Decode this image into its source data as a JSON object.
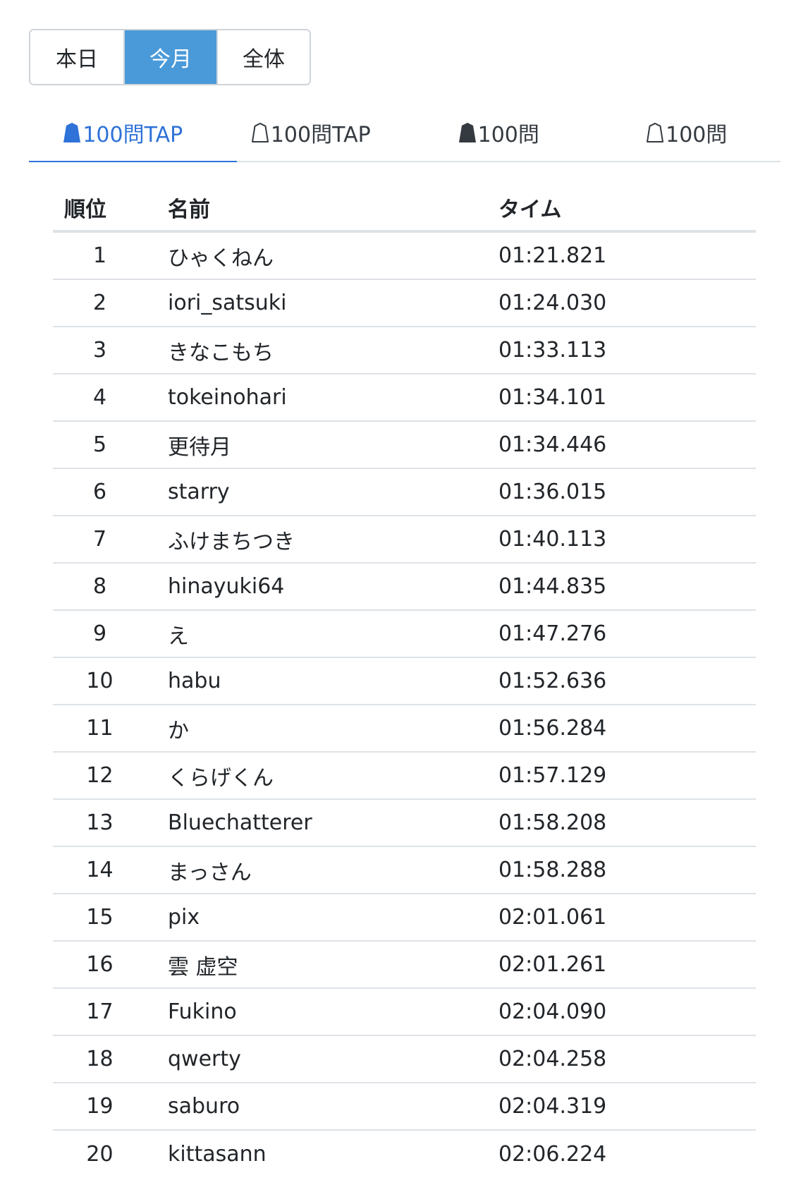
{
  "period_tabs": [
    {
      "label": "本日",
      "active": false
    },
    {
      "label": "今月",
      "active": true
    },
    {
      "label": "全体",
      "active": false
    }
  ],
  "mode_tabs": [
    {
      "label": "100問TAP",
      "icon": "shogi-piece-filled-icon",
      "active": true
    },
    {
      "label": "100問TAP",
      "icon": "shogi-piece-outline-icon",
      "active": false
    },
    {
      "label": "100問",
      "icon": "shogi-piece-filled-icon",
      "active": false
    },
    {
      "label": "100問",
      "icon": "shogi-piece-outline-icon",
      "active": false
    }
  ],
  "table": {
    "headers": {
      "rank": "順位",
      "name": "名前",
      "time": "タイム"
    },
    "rows": [
      {
        "rank": "1",
        "name": "ひゃくねん",
        "time": "01:21.821"
      },
      {
        "rank": "2",
        "name": "iori_satsuki",
        "time": "01:24.030"
      },
      {
        "rank": "3",
        "name": "きなこもち",
        "time": "01:33.113"
      },
      {
        "rank": "4",
        "name": "tokeinohari",
        "time": "01:34.101"
      },
      {
        "rank": "5",
        "name": "更待月",
        "time": "01:34.446"
      },
      {
        "rank": "6",
        "name": "starry",
        "time": "01:36.015"
      },
      {
        "rank": "7",
        "name": "ふけまちつき",
        "time": "01:40.113"
      },
      {
        "rank": "8",
        "name": "hinayuki64",
        "time": "01:44.835"
      },
      {
        "rank": "9",
        "name": "え",
        "time": "01:47.276"
      },
      {
        "rank": "10",
        "name": "habu",
        "time": "01:52.636"
      },
      {
        "rank": "11",
        "name": "か",
        "time": "01:56.284"
      },
      {
        "rank": "12",
        "name": "くらげくん",
        "time": "01:57.129"
      },
      {
        "rank": "13",
        "name": "Bluechatterer",
        "time": "01:58.208"
      },
      {
        "rank": "14",
        "name": "まっさん",
        "time": "01:58.288"
      },
      {
        "rank": "15",
        "name": "pix",
        "time": "02:01.061"
      },
      {
        "rank": "16",
        "name": "雲 虚空",
        "time": "02:01.261"
      },
      {
        "rank": "17",
        "name": "Fukino",
        "time": "02:04.090"
      },
      {
        "rank": "18",
        "name": "qwerty",
        "time": "02:04.258"
      },
      {
        "rank": "19",
        "name": "saburo",
        "time": "02:04.319"
      },
      {
        "rank": "20",
        "name": "kittasann",
        "time": "02:06.224"
      }
    ]
  },
  "colors": {
    "accent": "#2f72d8",
    "active_button": "#4a9ad9",
    "divider": "#dee2e6",
    "text": "#212529"
  }
}
